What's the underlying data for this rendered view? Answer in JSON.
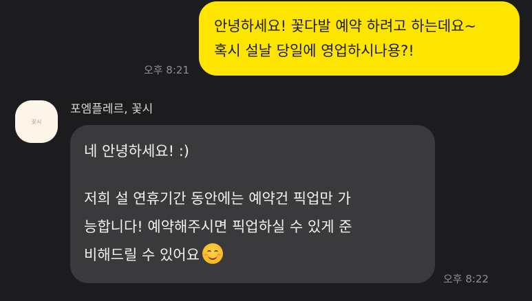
{
  "outgoing": {
    "lines": [
      "안녕하세요! 꽃다발 예약 하려고 하는데요~",
      "혹시 설날 당일에 영업하시나용?!"
    ],
    "time": "오후 8:21"
  },
  "incoming": {
    "sender": "포엠플레르, 꽃시",
    "avatar_logo_text": "꽃시",
    "lines": [
      "네 안녕하세요! :)",
      "저희 설 연휴기간 동안에는 예약건 픽업만 가",
      "능합니다! 예약해주시면 픽업하실 수 있게 준",
      "비해드릴 수 있어요"
    ],
    "emoji": "smiling-face-emoji",
    "time": "오후 8:22"
  },
  "colors": {
    "background": "#1c1c1e",
    "outgoing_bubble": "#fee500",
    "incoming_bubble": "#3a3a3c"
  }
}
